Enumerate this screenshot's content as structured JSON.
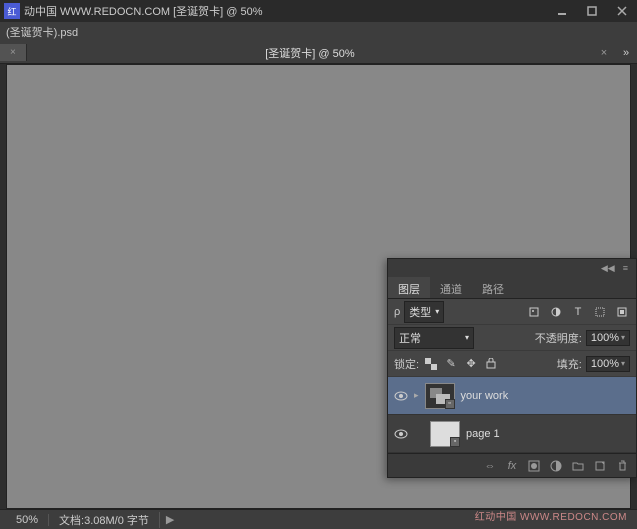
{
  "titlebar": {
    "logo_text": "红",
    "title": "动中国 WWW.REDOCN.COM [圣诞贺卡] @ 50%"
  },
  "doc_title_row": "(圣诞贺卡).psd",
  "tabs": {
    "center_label": "[圣诞贺卡] @ 50%"
  },
  "statusbar": {
    "zoom": "50%",
    "doc_info": "文档:3.08M/0 字节"
  },
  "panel": {
    "tabs": [
      "图层",
      "通道",
      "路径"
    ],
    "filter_icon": "ρ",
    "filter_label": "类型",
    "blend_mode": "正常",
    "opacity_label": "不透明度:",
    "opacity_value": "100%",
    "lock_label": "锁定:",
    "fill_label": "填充:",
    "fill_value": "100%",
    "layers": [
      {
        "name": "your work",
        "selected": true
      },
      {
        "name": "page 1",
        "selected": false
      }
    ]
  },
  "watermark": "红动中国 WWW.REDOCN.COM"
}
